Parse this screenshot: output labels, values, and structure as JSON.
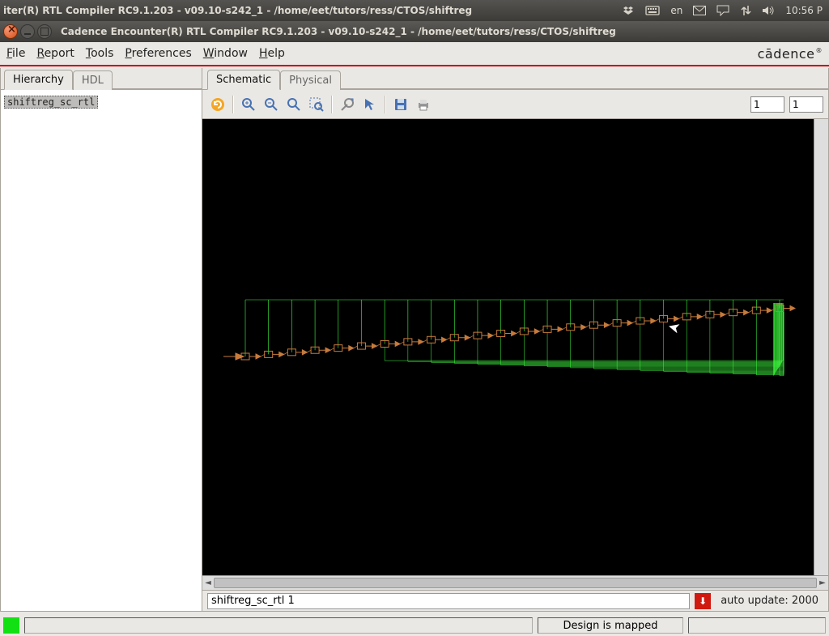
{
  "panel": {
    "title": "iter(R) RTL Compiler RC9.1.203 - v09.10-s242_1 - /home/eet/tutors/ress/CTOS/shiftreg",
    "lang": "en",
    "time": "10:56 P"
  },
  "window": {
    "title": "Cadence Encounter(R) RTL Compiler RC9.1.203 - v09.10-s242_1 - /home/eet/tutors/ress/CTOS/shiftreg"
  },
  "menus": {
    "file": "File",
    "report": "Report",
    "tools": "Tools",
    "prefs": "Preferences",
    "window": "Window",
    "help": "Help"
  },
  "brand": "cādence",
  "sidebar_tabs": {
    "hierarchy": "Hierarchy",
    "hdl": "HDL"
  },
  "tree": {
    "item0": "shiftreg_sc_rtl"
  },
  "main_tabs": {
    "schematic": "Schematic",
    "physical": "Physical"
  },
  "toolbar_inputs": {
    "a": "1",
    "b": "1"
  },
  "status": {
    "path": "shiftreg_sc_rtl 1",
    "auto": "auto update: 2000"
  },
  "appbar": {
    "design": "Design is mapped"
  }
}
